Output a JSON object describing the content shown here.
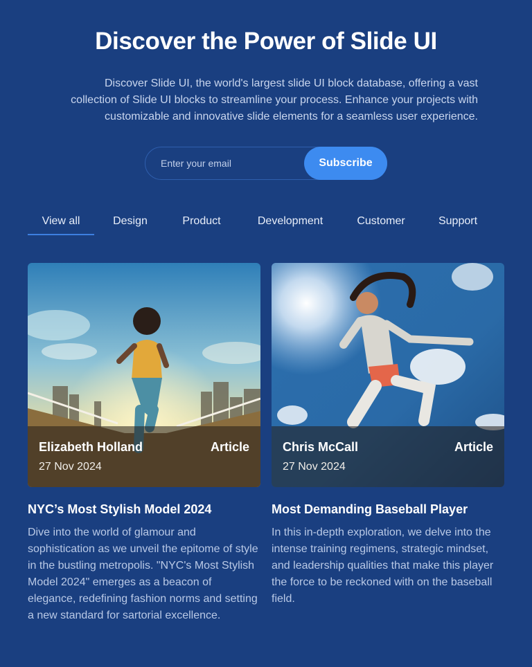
{
  "hero": {
    "title": "Discover the Power of Slide UI",
    "description": "Discover Slide UI, the world's largest slide UI block database, offering a vast collection of Slide UI blocks to streamline your process. Enhance your projects with customizable and innovative slide elements for a seamless user experience."
  },
  "subscribe": {
    "placeholder": "Enter your email",
    "value": "",
    "button_label": "Subscribe"
  },
  "tabs": [
    {
      "label": "View all",
      "active": true
    },
    {
      "label": "Design",
      "active": false
    },
    {
      "label": "Product",
      "active": false
    },
    {
      "label": "Development",
      "active": false
    },
    {
      "label": "Customer",
      "active": false
    },
    {
      "label": "Support",
      "active": false
    }
  ],
  "cards": [
    {
      "author": "Elizabeth Holland",
      "tag": "Article",
      "date": "27 Nov 2024",
      "title": "NYC’s Most Stylish Model 2024",
      "body": "Dive into the world of glamour and sophistication as we unveil the epitome of style in the bustling metropolis. \"NYC's Most Stylish Model 2024\" emerges as a beacon of elegance, redefining fashion norms and setting a new standard for sartorial excellence.",
      "image_icon": "runner-city-photo"
    },
    {
      "author": "Chris McCall",
      "tag": "Article",
      "date": "27 Nov 2024",
      "title": "Most Demanding Baseball Player",
      "body": "In this in-depth exploration, we delve into the intense training regimens, strategic mindset, and leadership qualities that make this player the force to be reckoned with on the baseball field.",
      "image_icon": "jumping-athlete-sky-photo"
    }
  ],
  "colors": {
    "background": "#1a3f80",
    "accent": "#3d8bf0",
    "muted_text": "#b9c9e6"
  }
}
